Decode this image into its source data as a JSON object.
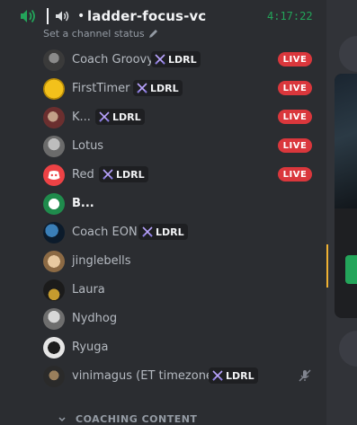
{
  "channel": {
    "name": "ladder-focus-vc",
    "bullet": "•",
    "timer": "4:17:22",
    "status_text": "Set a channel status"
  },
  "tag_label": "LDRL",
  "live_label": "LIVE",
  "members": [
    {
      "name": "Coach Groovy",
      "tag": true,
      "live": true
    },
    {
      "name": "FirstTimer",
      "tag": true,
      "live": true
    },
    {
      "name": "K...",
      "tag": true,
      "live": true
    },
    {
      "name": "Lotus",
      "tag": false,
      "live": true
    },
    {
      "name": "Red",
      "tag": true,
      "live": true
    },
    {
      "name": "B...",
      "tag": false,
      "live": false
    },
    {
      "name": "Coach EON",
      "tag": true,
      "live": false
    },
    {
      "name": "jinglebells",
      "tag": false,
      "live": false
    },
    {
      "name": "Laura",
      "tag": false,
      "live": false
    },
    {
      "name": "Nydhog",
      "tag": false,
      "live": false
    },
    {
      "name": "Ryuga",
      "tag": false,
      "live": false
    },
    {
      "name": "vinimagus (ET timezone)",
      "tag": true,
      "live": false,
      "muted": true
    }
  ],
  "bottom_category": "COACHING CONTENT",
  "colors": {
    "live": "#da373c",
    "timer": "#23a55a",
    "voice_connected": "#23a55a"
  }
}
